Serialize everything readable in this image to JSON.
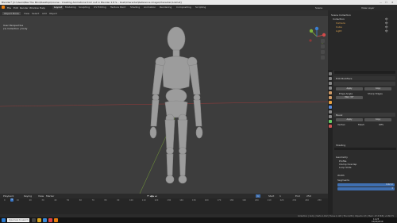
{
  "window": {
    "title": "Blender* [C:\\Users\\Bas The Mini\\Desktop\\Course - Creating Animations from A-Z in Blender 2.8 S... Rust\\Character\\Reference image\\Character\\Animat]",
    "min": "—",
    "max": "☐",
    "close": "✕"
  },
  "menu": [
    "File",
    "Edit",
    "Render",
    "Window",
    "Help"
  ],
  "workspaces": [
    {
      "label": "Layout",
      "active": true
    },
    {
      "label": "Modeling"
    },
    {
      "label": "Sculpting"
    },
    {
      "label": "UV Editing"
    },
    {
      "label": "Texture Paint"
    },
    {
      "label": "Shading"
    },
    {
      "label": "Animation"
    },
    {
      "label": "Rendering"
    },
    {
      "label": "Compositing"
    },
    {
      "label": "Scripting"
    }
  ],
  "topright": {
    "scene": "Scene",
    "view_layer": "View Layer"
  },
  "viewport": {
    "mode": "Object Mode",
    "menus": [
      "View",
      "Select",
      "Add",
      "Object"
    ],
    "overlay_line1": "User Perspective",
    "overlay_line2": "(1) Collection | body",
    "gizmo_labels": {
      "x": "X",
      "y": "Y",
      "z": "Z"
    }
  },
  "timeline": {
    "menus": [
      "Playback",
      "Keying",
      "View",
      "Marker"
    ],
    "current_frame": "1",
    "ticks": [
      "0",
      "10",
      "20",
      "30",
      "40",
      "50",
      "60",
      "70",
      "80",
      "90",
      "100",
      "110",
      "120",
      "130",
      "140",
      "150",
      "160",
      "170",
      "180",
      "190",
      "200",
      "210",
      "220",
      "230",
      "240",
      "250"
    ],
    "start_label": "Start",
    "start": "1",
    "end_label": "End",
    "end": "250"
  },
  "outliner": {
    "rows": [
      "Scene Collection",
      "Collection",
      "Camera",
      "Cube",
      "Light"
    ]
  },
  "properties": {
    "search_placeholder": "",
    "panel1": {
      "title": "Edit Modifiers",
      "buttons": [
        "Apply",
        "Copy"
      ],
      "checks": [
        "Edge Angle",
        "Sharp Edges"
      ],
      "field": "Max: 30°"
    },
    "panel2": {
      "title": "Bevel",
      "buttons": [
        "Apply",
        "Copy"
      ],
      "cols": [
        "Vertex",
        "Mesh",
        "Offs"
      ]
    },
    "shading_title": "Shading",
    "geometry": {
      "title": "Geometry",
      "rows": [
        "Profile",
        "Clamp Overlap",
        "Loop Slide"
      ]
    },
    "width_label": "Width",
    "width": "0.02 m",
    "segments_label": "Segments",
    "segments": "3"
  },
  "statusbar": {
    "text": "Collection | body | Verts:1,192 | Faces:1,126 | Tris:2,284 | Objects:1/3 | Mem: 47.5 MiB | v2.80.75"
  },
  "taskbar": {
    "search_placeholder": "Type here to search",
    "time": "11:23",
    "date": "10/22/2019"
  }
}
